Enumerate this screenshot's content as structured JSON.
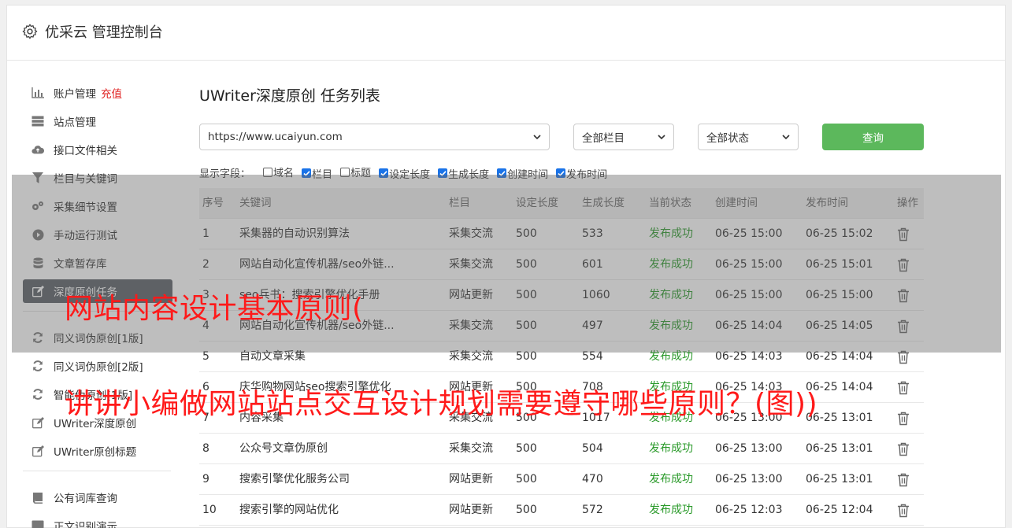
{
  "brand": {
    "title": "优采云 管理控制台",
    "icon": "gear-icon"
  },
  "sidebar": {
    "items": [
      {
        "label": "账户管理",
        "badge": "充值",
        "icon": "bar-chart-icon"
      },
      {
        "label": "站点管理",
        "icon": "server-icon"
      },
      {
        "label": "接口文件相关",
        "icon": "cloud-upload-icon"
      },
      {
        "label": "栏目与关键词",
        "icon": "filter-icon"
      },
      {
        "label": "采集细节设置",
        "icon": "cogs-icon"
      },
      {
        "label": "手动运行测试",
        "icon": "play-circle-icon"
      },
      {
        "label": "文章暂存库",
        "icon": "database-icon"
      },
      {
        "label": "深度原创任务",
        "icon": "edit-icon",
        "active": true
      }
    ],
    "items2": [
      {
        "label": "同义词伪原创[1版]",
        "icon": "refresh-icon"
      },
      {
        "label": "同义词伪原创[2版]",
        "icon": "refresh-icon"
      },
      {
        "label": "智能伪原创[1版]",
        "icon": "refresh-icon"
      },
      {
        "label": "UWriter深度原创",
        "icon": "edit-icon"
      },
      {
        "label": "UWriter原创标题",
        "icon": "edit-icon"
      }
    ],
    "items3": [
      {
        "label": "公有词库查询",
        "icon": "book-icon"
      },
      {
        "label": "正文识别演示",
        "icon": "monitor-icon"
      }
    ]
  },
  "main": {
    "title": "UWriter深度原创 任务列表",
    "site_select": "https://www.ucaiyun.com",
    "column_select": "全部栏目",
    "status_select": "全部状态",
    "query_label": "查询",
    "fields_label": "显示字段：",
    "fields": [
      {
        "label": "域名",
        "checked": false
      },
      {
        "label": "栏目",
        "checked": true
      },
      {
        "label": "标题",
        "checked": false
      },
      {
        "label": "设定长度",
        "checked": true
      },
      {
        "label": "生成长度",
        "checked": true
      },
      {
        "label": "创建时间",
        "checked": true
      },
      {
        "label": "发布时间",
        "checked": true
      }
    ],
    "table": {
      "headers": [
        "序号",
        "关键词",
        "栏目",
        "设定长度",
        "生成长度",
        "当前状态",
        "创建时间",
        "发布时间",
        "操作"
      ],
      "rows": [
        [
          "1",
          "采集器的自动识别算法",
          "采集交流",
          "500",
          "533",
          "发布成功",
          "06-25 15:00",
          "06-25 15:02"
        ],
        [
          "2",
          "网站自动化宣传机器/seo外链...",
          "采集交流",
          "500",
          "601",
          "发布成功",
          "06-25 15:00",
          "06-25 15:01"
        ],
        [
          "3",
          "seo兵书：搜索引擎优化手册",
          "网站更新",
          "500",
          "1060",
          "发布成功",
          "06-25 15:00",
          "06-25 15:00"
        ],
        [
          "4",
          "网站自动化宣传机器/seo外链...",
          "采集交流",
          "500",
          "497",
          "发布成功",
          "06-25 14:04",
          "06-25 14:05"
        ],
        [
          "5",
          "自动文章采集",
          "采集交流",
          "500",
          "554",
          "发布成功",
          "06-25 14:03",
          "06-25 14:04"
        ],
        [
          "6",
          "庆华购物网站seo搜索引擎优化",
          "网站更新",
          "500",
          "708",
          "发布成功",
          "06-25 14:03",
          "06-25 14:04"
        ],
        [
          "7",
          "内容采集",
          "采集交流",
          "500",
          "1017",
          "发布成功",
          "06-25 13:00",
          "06-25 13:01"
        ],
        [
          "8",
          "公众号文章伪原创",
          "采集交流",
          "500",
          "504",
          "发布成功",
          "06-25 13:00",
          "06-25 13:01"
        ],
        [
          "9",
          "搜索引擎优化服务公司",
          "网站更新",
          "500",
          "470",
          "发布成功",
          "06-25 13:00",
          "06-25 13:01"
        ],
        [
          "10",
          "搜索引擎的网站优化",
          "网站更新",
          "500",
          "572",
          "发布成功",
          "06-25 12:03",
          "06-25 12:04"
        ]
      ]
    }
  },
  "watermark": {
    "line1": "网站内容设计基本原则(",
    "line2": "讲讲小编做网站站点交互设计规划需要遵守哪些原则？(图))"
  },
  "colors": {
    "accent_green": "#5cb85c",
    "success_text": "#2a9a2a",
    "recharge_red": "#e02020",
    "active_nav": "#5b6067",
    "watermark_red": "#ff1a1a"
  }
}
